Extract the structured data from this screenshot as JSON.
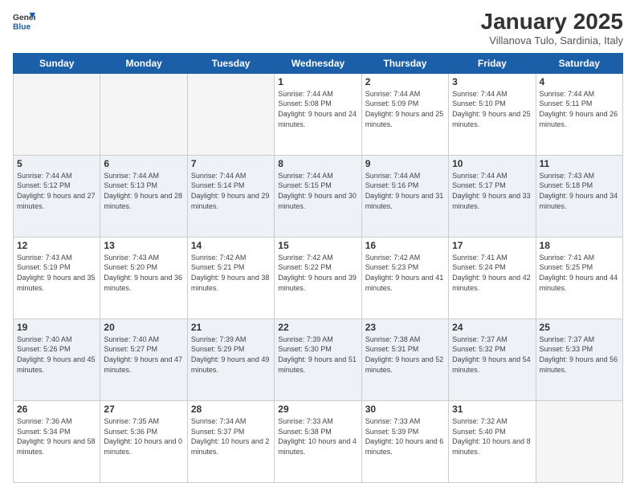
{
  "logo": {
    "text_general": "General",
    "text_blue": "Blue"
  },
  "title": "January 2025",
  "subtitle": "Villanova Tulo, Sardinia, Italy",
  "days_of_week": [
    "Sunday",
    "Monday",
    "Tuesday",
    "Wednesday",
    "Thursday",
    "Friday",
    "Saturday"
  ],
  "weeks": [
    [
      {
        "day": "",
        "sunrise": "",
        "sunset": "",
        "daylight": ""
      },
      {
        "day": "",
        "sunrise": "",
        "sunset": "",
        "daylight": ""
      },
      {
        "day": "",
        "sunrise": "",
        "sunset": "",
        "daylight": ""
      },
      {
        "day": "1",
        "sunrise": "Sunrise: 7:44 AM",
        "sunset": "Sunset: 5:08 PM",
        "daylight": "Daylight: 9 hours and 24 minutes."
      },
      {
        "day": "2",
        "sunrise": "Sunrise: 7:44 AM",
        "sunset": "Sunset: 5:09 PM",
        "daylight": "Daylight: 9 hours and 25 minutes."
      },
      {
        "day": "3",
        "sunrise": "Sunrise: 7:44 AM",
        "sunset": "Sunset: 5:10 PM",
        "daylight": "Daylight: 9 hours and 25 minutes."
      },
      {
        "day": "4",
        "sunrise": "Sunrise: 7:44 AM",
        "sunset": "Sunset: 5:11 PM",
        "daylight": "Daylight: 9 hours and 26 minutes."
      }
    ],
    [
      {
        "day": "5",
        "sunrise": "Sunrise: 7:44 AM",
        "sunset": "Sunset: 5:12 PM",
        "daylight": "Daylight: 9 hours and 27 minutes."
      },
      {
        "day": "6",
        "sunrise": "Sunrise: 7:44 AM",
        "sunset": "Sunset: 5:13 PM",
        "daylight": "Daylight: 9 hours and 28 minutes."
      },
      {
        "day": "7",
        "sunrise": "Sunrise: 7:44 AM",
        "sunset": "Sunset: 5:14 PM",
        "daylight": "Daylight: 9 hours and 29 minutes."
      },
      {
        "day": "8",
        "sunrise": "Sunrise: 7:44 AM",
        "sunset": "Sunset: 5:15 PM",
        "daylight": "Daylight: 9 hours and 30 minutes."
      },
      {
        "day": "9",
        "sunrise": "Sunrise: 7:44 AM",
        "sunset": "Sunset: 5:16 PM",
        "daylight": "Daylight: 9 hours and 31 minutes."
      },
      {
        "day": "10",
        "sunrise": "Sunrise: 7:44 AM",
        "sunset": "Sunset: 5:17 PM",
        "daylight": "Daylight: 9 hours and 33 minutes."
      },
      {
        "day": "11",
        "sunrise": "Sunrise: 7:43 AM",
        "sunset": "Sunset: 5:18 PM",
        "daylight": "Daylight: 9 hours and 34 minutes."
      }
    ],
    [
      {
        "day": "12",
        "sunrise": "Sunrise: 7:43 AM",
        "sunset": "Sunset: 5:19 PM",
        "daylight": "Daylight: 9 hours and 35 minutes."
      },
      {
        "day": "13",
        "sunrise": "Sunrise: 7:43 AM",
        "sunset": "Sunset: 5:20 PM",
        "daylight": "Daylight: 9 hours and 36 minutes."
      },
      {
        "day": "14",
        "sunrise": "Sunrise: 7:42 AM",
        "sunset": "Sunset: 5:21 PM",
        "daylight": "Daylight: 9 hours and 38 minutes."
      },
      {
        "day": "15",
        "sunrise": "Sunrise: 7:42 AM",
        "sunset": "Sunset: 5:22 PM",
        "daylight": "Daylight: 9 hours and 39 minutes."
      },
      {
        "day": "16",
        "sunrise": "Sunrise: 7:42 AM",
        "sunset": "Sunset: 5:23 PM",
        "daylight": "Daylight: 9 hours and 41 minutes."
      },
      {
        "day": "17",
        "sunrise": "Sunrise: 7:41 AM",
        "sunset": "Sunset: 5:24 PM",
        "daylight": "Daylight: 9 hours and 42 minutes."
      },
      {
        "day": "18",
        "sunrise": "Sunrise: 7:41 AM",
        "sunset": "Sunset: 5:25 PM",
        "daylight": "Daylight: 9 hours and 44 minutes."
      }
    ],
    [
      {
        "day": "19",
        "sunrise": "Sunrise: 7:40 AM",
        "sunset": "Sunset: 5:26 PM",
        "daylight": "Daylight: 9 hours and 45 minutes."
      },
      {
        "day": "20",
        "sunrise": "Sunrise: 7:40 AM",
        "sunset": "Sunset: 5:27 PM",
        "daylight": "Daylight: 9 hours and 47 minutes."
      },
      {
        "day": "21",
        "sunrise": "Sunrise: 7:39 AM",
        "sunset": "Sunset: 5:29 PM",
        "daylight": "Daylight: 9 hours and 49 minutes."
      },
      {
        "day": "22",
        "sunrise": "Sunrise: 7:39 AM",
        "sunset": "Sunset: 5:30 PM",
        "daylight": "Daylight: 9 hours and 51 minutes."
      },
      {
        "day": "23",
        "sunrise": "Sunrise: 7:38 AM",
        "sunset": "Sunset: 5:31 PM",
        "daylight": "Daylight: 9 hours and 52 minutes."
      },
      {
        "day": "24",
        "sunrise": "Sunrise: 7:37 AM",
        "sunset": "Sunset: 5:32 PM",
        "daylight": "Daylight: 9 hours and 54 minutes."
      },
      {
        "day": "25",
        "sunrise": "Sunrise: 7:37 AM",
        "sunset": "Sunset: 5:33 PM",
        "daylight": "Daylight: 9 hours and 56 minutes."
      }
    ],
    [
      {
        "day": "26",
        "sunrise": "Sunrise: 7:36 AM",
        "sunset": "Sunset: 5:34 PM",
        "daylight": "Daylight: 9 hours and 58 minutes."
      },
      {
        "day": "27",
        "sunrise": "Sunrise: 7:35 AM",
        "sunset": "Sunset: 5:36 PM",
        "daylight": "Daylight: 10 hours and 0 minutes."
      },
      {
        "day": "28",
        "sunrise": "Sunrise: 7:34 AM",
        "sunset": "Sunset: 5:37 PM",
        "daylight": "Daylight: 10 hours and 2 minutes."
      },
      {
        "day": "29",
        "sunrise": "Sunrise: 7:33 AM",
        "sunset": "Sunset: 5:38 PM",
        "daylight": "Daylight: 10 hours and 4 minutes."
      },
      {
        "day": "30",
        "sunrise": "Sunrise: 7:33 AM",
        "sunset": "Sunset: 5:39 PM",
        "daylight": "Daylight: 10 hours and 6 minutes."
      },
      {
        "day": "31",
        "sunrise": "Sunrise: 7:32 AM",
        "sunset": "Sunset: 5:40 PM",
        "daylight": "Daylight: 10 hours and 8 minutes."
      },
      {
        "day": "",
        "sunrise": "",
        "sunset": "",
        "daylight": ""
      }
    ]
  ]
}
